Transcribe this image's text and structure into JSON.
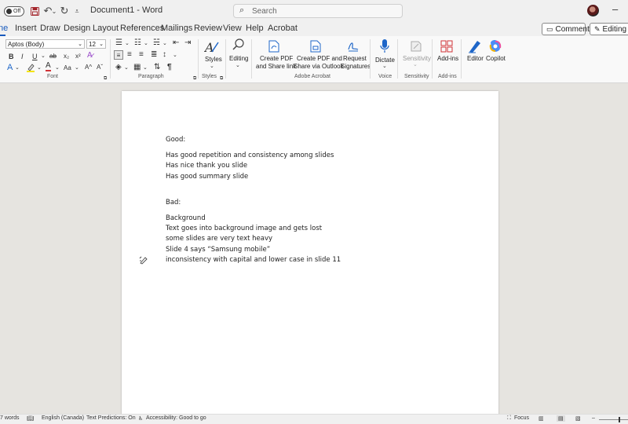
{
  "titlebar": {
    "autosave_state": "Off",
    "doc_title": "Document1 - Word",
    "search_placeholder": "Search"
  },
  "tabs": [
    {
      "label": "ne"
    },
    {
      "label": "Insert"
    },
    {
      "label": "Draw"
    },
    {
      "label": "Design"
    },
    {
      "label": "Layout"
    },
    {
      "label": "References"
    },
    {
      "label": "Mailings"
    },
    {
      "label": "Review"
    },
    {
      "label": "View"
    },
    {
      "label": "Help"
    },
    {
      "label": "Acrobat"
    }
  ],
  "tab_buttons": {
    "comments": "Comments",
    "editing": "Editing"
  },
  "ribbon": {
    "font_name": "Aptos (Body)",
    "font_size": "12",
    "groups": {
      "font": "Font",
      "paragraph": "Paragraph",
      "styles": "Styles",
      "adobe": "Adobe Acrobat",
      "voice": "Voice",
      "sensitivity": "Sensitivity",
      "addins": "Add-ins"
    },
    "buttons": {
      "styles": "Styles",
      "editing": "Editing",
      "create_pdf_1": "Create PDF",
      "create_pdf_2": "and Share link",
      "share_outlook_1": "Create PDF and",
      "share_outlook_2": "Share via Outlook",
      "request_sig_1": "Request",
      "request_sig_2": "Signatures",
      "dictate": "Dictate",
      "sensitivity": "Sensitivity",
      "addins": "Add-ins",
      "editor": "Editor",
      "copilot": "Copilot"
    },
    "format_labels": {
      "bold": "B",
      "italic": "I",
      "underline": "U",
      "strike": "ab",
      "sub": "x₂",
      "sup": "x²",
      "case": "Aa",
      "grow": "A^",
      "shrink": "Aˇ"
    }
  },
  "document": {
    "paragraphs": [
      "Good:",
      "Has good repetition and consistency among slides",
      "Has nice thank you slide",
      "Has good summary slide",
      "Bad:",
      "Background",
      "Text goes into background image and gets lost",
      "some slides are very text heavy",
      "Slide 4 says “Samsung mobile”",
      "inconsistency with capital and lower case in slide 11"
    ]
  },
  "statusbar": {
    "words": "7 words",
    "language": "English (Canada)",
    "predictions": "Text Predictions: On",
    "accessibility": "Accessibility: Good to go",
    "focus": "Focus"
  }
}
